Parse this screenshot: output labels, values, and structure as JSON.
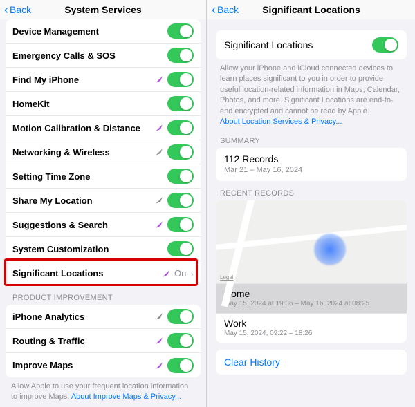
{
  "left": {
    "back": "Back",
    "title": "System Services",
    "group1": [
      {
        "name": "device-management",
        "label": "Device Management",
        "arrow": null,
        "toggle": true
      },
      {
        "name": "emergency-sos",
        "label": "Emergency Calls & SOS",
        "arrow": null,
        "toggle": true
      },
      {
        "name": "find-my-iphone",
        "label": "Find My iPhone",
        "arrow": "purple",
        "toggle": true
      },
      {
        "name": "homekit",
        "label": "HomeKit",
        "arrow": null,
        "toggle": true
      },
      {
        "name": "motion-calibration",
        "label": "Motion Calibration & Distance",
        "arrow": "purple",
        "toggle": true
      },
      {
        "name": "networking-wireless",
        "label": "Networking & Wireless",
        "arrow": "gray",
        "toggle": true
      },
      {
        "name": "setting-time-zone",
        "label": "Setting Time Zone",
        "arrow": null,
        "toggle": true
      },
      {
        "name": "share-my-location",
        "label": "Share My Location",
        "arrow": "gray",
        "toggle": true
      },
      {
        "name": "suggestions-search",
        "label": "Suggestions & Search",
        "arrow": "purple",
        "toggle": true
      },
      {
        "name": "system-customization",
        "label": "System Customization",
        "arrow": null,
        "toggle": true
      },
      {
        "name": "significant-locations",
        "label": "Significant Locations",
        "arrow": "purple",
        "value": "On",
        "chevron": true
      }
    ],
    "section2": "PRODUCT IMPROVEMENT",
    "group2": [
      {
        "name": "iphone-analytics",
        "label": "iPhone Analytics",
        "arrow": "gray",
        "toggle": true
      },
      {
        "name": "routing-traffic",
        "label": "Routing & Traffic",
        "arrow": "purple",
        "toggle": true
      },
      {
        "name": "improve-maps",
        "label": "Improve Maps",
        "arrow": "purple",
        "toggle": true
      }
    ],
    "footer": "Allow Apple to use your frequent location information to improve Maps. ",
    "footer_link": "About Improve Maps & Privacy..."
  },
  "right": {
    "back": "Back",
    "title": "Significant Locations",
    "toggle_label": "Significant Locations",
    "desc": "Allow your iPhone and iCloud connected devices to learn places significant to you in order to provide useful location-related information in Maps, Calendar, Photos, and more. Significant Locations are end-to-end encrypted and cannot be read by Apple.",
    "desc_link": "About Location Services & Privacy...",
    "summary_header": "SUMMARY",
    "summary_title": "112 Records",
    "summary_sub": "Mar 21 – May 16, 2024",
    "records_header": "RECENT RECORDS",
    "map_legal": "Legal",
    "records": [
      {
        "name": "record-home",
        "title": "Home",
        "sub": "May 15, 2024 at 19:36 – May 16, 2024 at 08:25",
        "selected": true
      },
      {
        "name": "record-work",
        "title": "Work",
        "sub": "May 15, 2024, 09:22 – 18:26",
        "selected": false
      }
    ],
    "clear": "Clear History"
  }
}
